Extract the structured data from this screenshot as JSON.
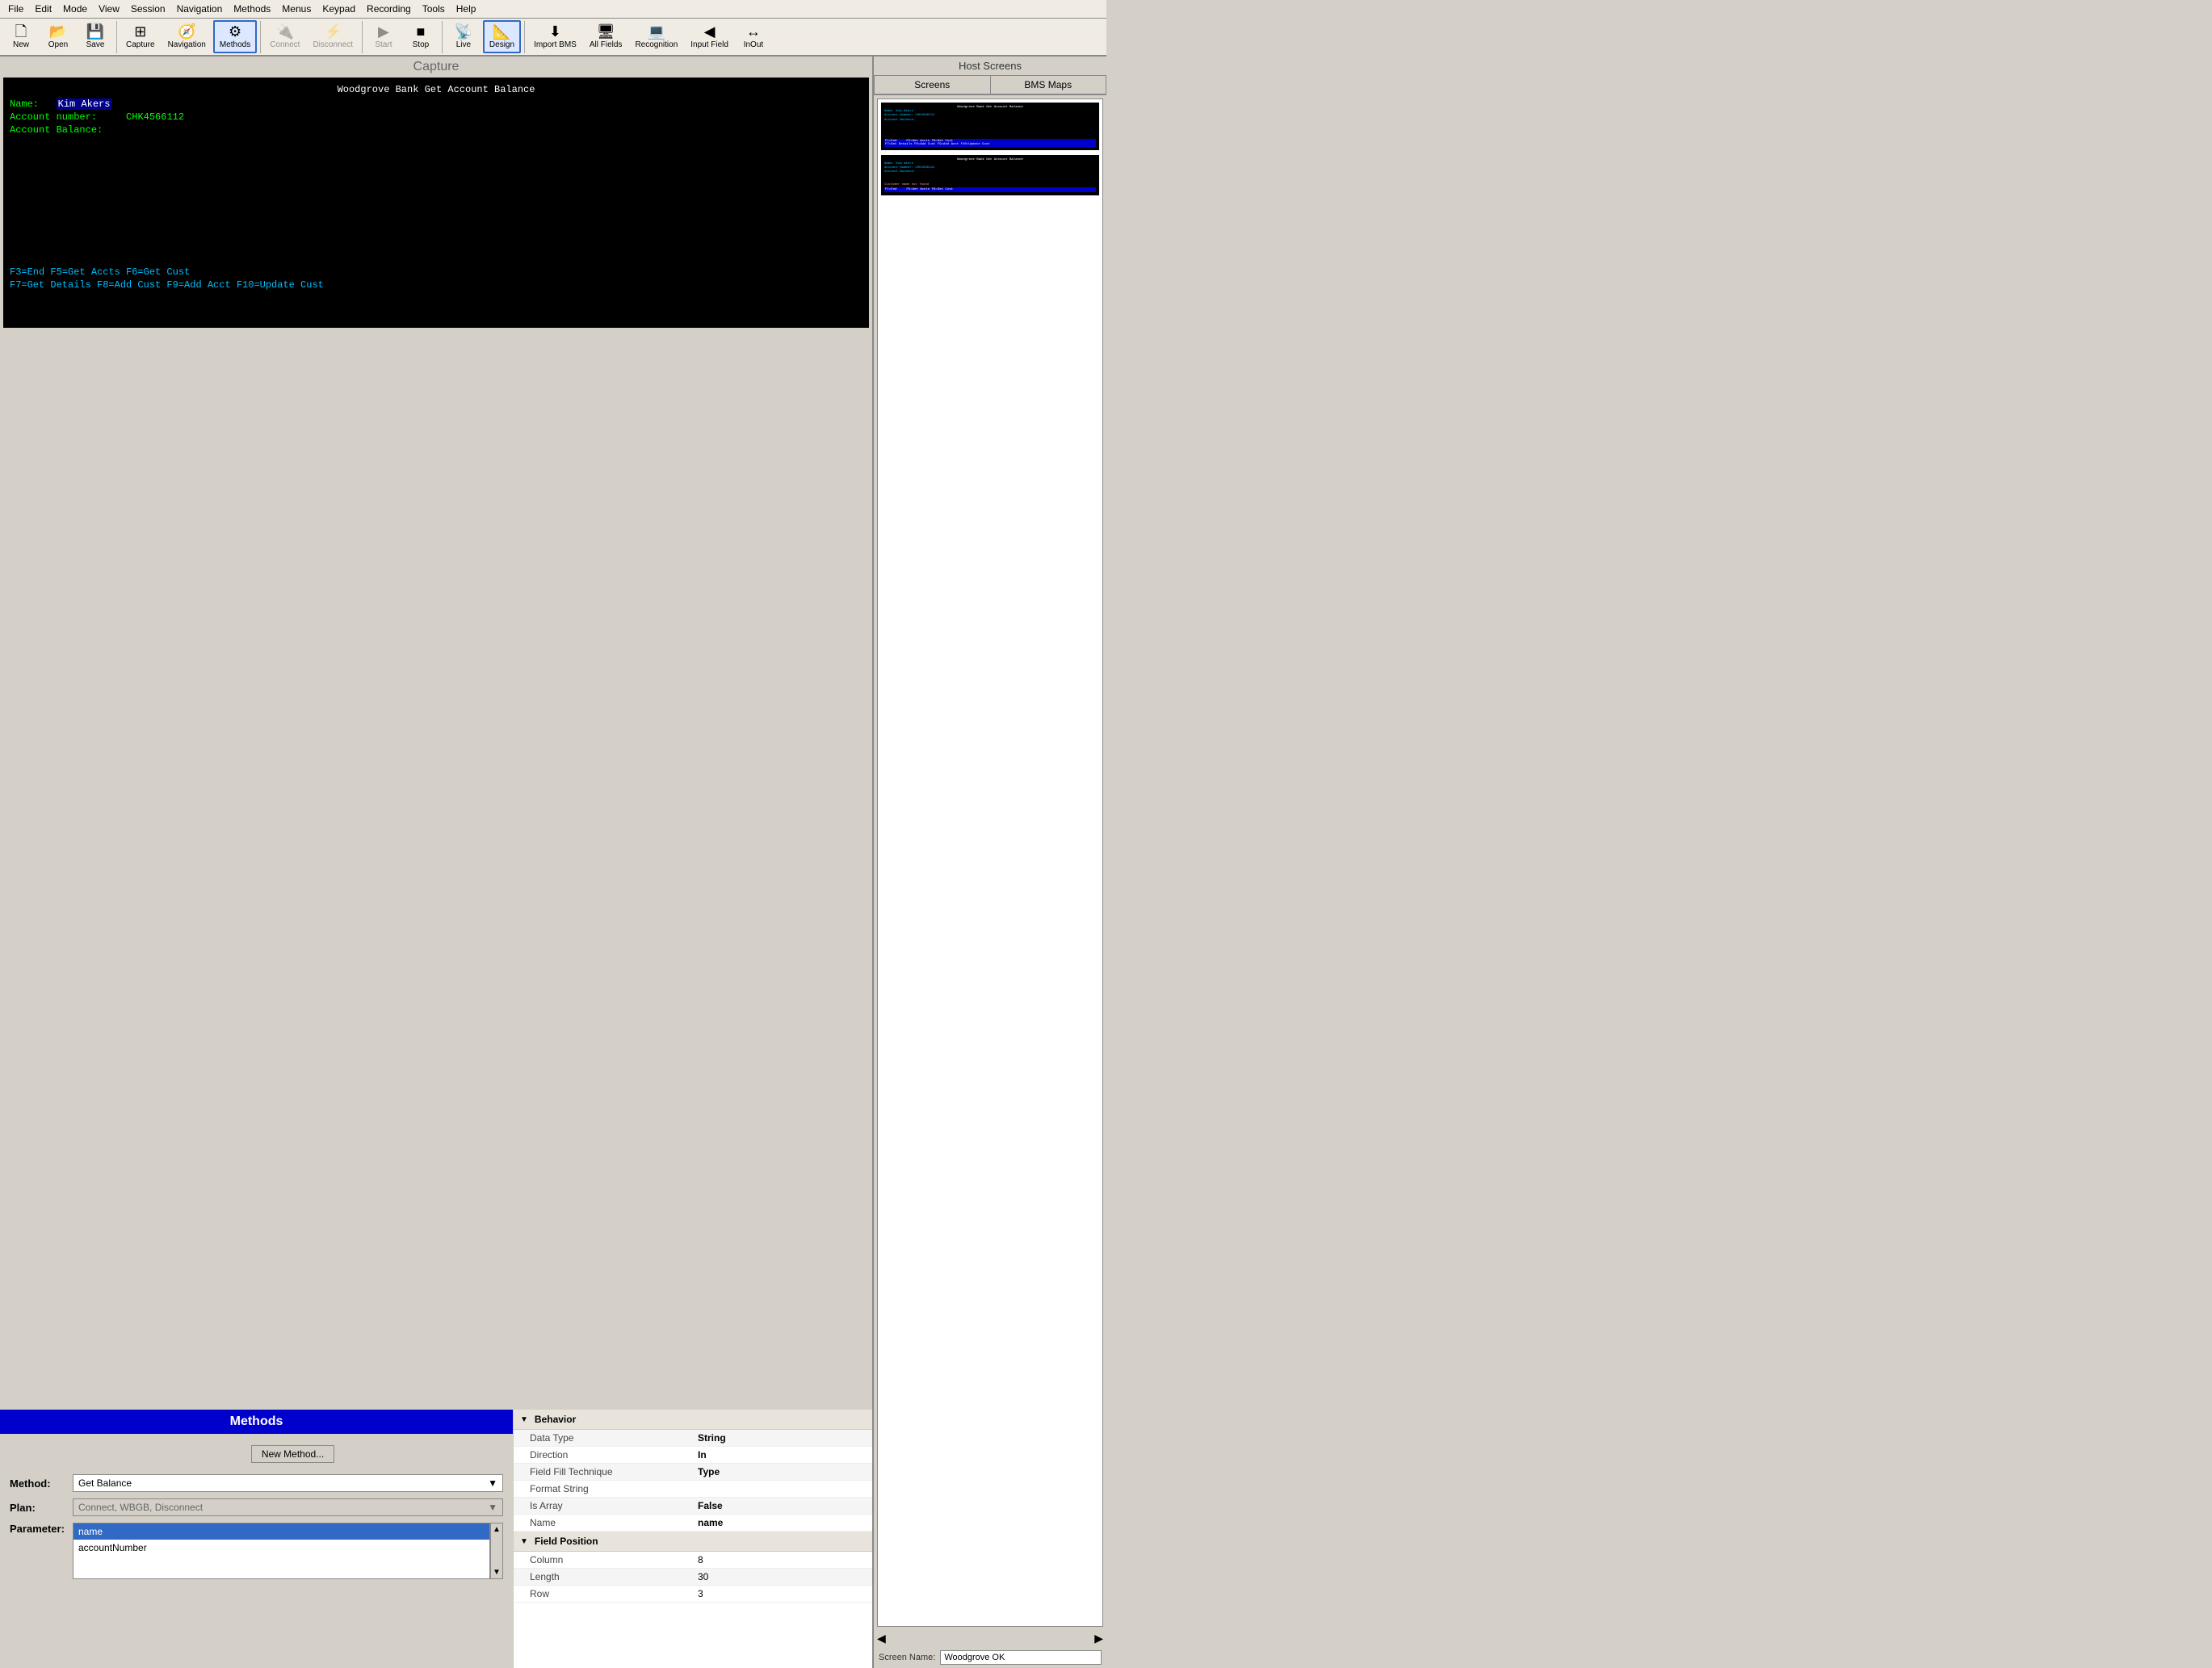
{
  "menubar": {
    "items": [
      "File",
      "Edit",
      "Mode",
      "View",
      "Session",
      "Navigation",
      "Methods",
      "Menus",
      "Keypad",
      "Recording",
      "Tools",
      "Help"
    ]
  },
  "toolbar": {
    "buttons": [
      {
        "label": "New",
        "icon": "🗋",
        "name": "new-btn",
        "disabled": false,
        "active": false
      },
      {
        "label": "Open",
        "icon": "📂",
        "name": "open-btn",
        "disabled": false,
        "active": false
      },
      {
        "label": "Save",
        "icon": "💾",
        "name": "save-btn",
        "disabled": false,
        "active": false
      },
      {
        "label": "Capture",
        "icon": "⊞",
        "name": "capture-btn",
        "disabled": false,
        "active": false
      },
      {
        "label": "Navigation",
        "icon": "🧭",
        "name": "navigation-btn",
        "disabled": false,
        "active": false
      },
      {
        "label": "Methods",
        "icon": "⚙",
        "name": "methods-btn",
        "disabled": false,
        "active": true
      },
      {
        "label": "Connect",
        "icon": "🔌",
        "name": "connect-btn",
        "disabled": true,
        "active": false
      },
      {
        "label": "Disconnect",
        "icon": "⚡",
        "name": "disconnect-btn",
        "disabled": true,
        "active": false
      },
      {
        "label": "Start",
        "icon": "▶",
        "name": "start-btn",
        "disabled": true,
        "active": false
      },
      {
        "label": "Stop",
        "icon": "■",
        "name": "stop-btn",
        "disabled": false,
        "active": false
      },
      {
        "label": "Live",
        "icon": "📡",
        "name": "live-btn",
        "disabled": false,
        "active": false
      },
      {
        "label": "Design",
        "icon": "📐",
        "name": "design-btn",
        "disabled": false,
        "active": true
      },
      {
        "label": "Import BMS",
        "icon": "⬇",
        "name": "import-bms-btn",
        "disabled": false,
        "active": false
      },
      {
        "label": "All Fields",
        "icon": "🖥",
        "name": "all-fields-btn",
        "disabled": false,
        "active": false
      },
      {
        "label": "Recognition",
        "icon": "💻",
        "name": "recognition-btn",
        "disabled": false,
        "active": false
      },
      {
        "label": "Input Field",
        "icon": "◀",
        "name": "input-field-btn",
        "disabled": false,
        "active": false
      },
      {
        "label": "InOut",
        "icon": "↔",
        "name": "inout-btn",
        "disabled": false,
        "active": false
      }
    ]
  },
  "capture": {
    "title": "Capture",
    "terminal": {
      "screen_title": "Woodgrove Bank Get Account Balance",
      "name_label": "Name:",
      "name_value": "Kim Akers",
      "account_number_label": "Account number:",
      "account_number_value": "CHK4566112",
      "account_balance_label": "Account Balance:",
      "keys_line1": "F3=End                    F5=Get Accts F6=Get Cust",
      "keys_line2": "F7=Get Details F8=Add Cust    F9=Add Acct  F10=Update Cust"
    }
  },
  "host_screens": {
    "title": "Host Screens",
    "tabs": [
      "Screens",
      "BMS Maps"
    ],
    "screen_name_label": "Screen Name:",
    "screen_name_value": "Woodgrove OK",
    "thumb1": {
      "title": "Woodgrove Bank Get Account Balance",
      "lines": [
        "Name: Kim Akers",
        "Account Number: CHK4566112",
        "Account Balance:"
      ]
    },
    "thumb2": {
      "title": "Woodgrove Bank Get Account Balance",
      "lines": [
        "Name: Kim Akers",
        "Account Number: CHK4566112",
        "Account Balance:"
      ],
      "error": "Customer name not found"
    }
  },
  "methods": {
    "header": "Methods",
    "new_method_label": "New Method...",
    "method_label": "Method:",
    "method_value": "Get Balance",
    "plan_label": "Plan:",
    "plan_value": "Connect, WBGB, Disconnect",
    "parameter_label": "Parameter:",
    "parameters": [
      "name",
      "accountNumber"
    ],
    "selected_param": 0
  },
  "properties": {
    "behavior_label": "Behavior",
    "field_position_label": "Field Position",
    "rows": [
      {
        "name": "Data Type",
        "value": "String",
        "bold": true
      },
      {
        "name": "Direction",
        "value": "In",
        "bold": true
      },
      {
        "name": "Field Fill Technique",
        "value": "Type",
        "bold": true
      },
      {
        "name": "Format String",
        "value": "",
        "bold": false
      },
      {
        "name": "Is Array",
        "value": "False",
        "bold": true
      },
      {
        "name": "Name",
        "value": "name",
        "bold": true
      }
    ],
    "position_rows": [
      {
        "name": "Column",
        "value": "8",
        "bold": false
      },
      {
        "name": "Length",
        "value": "30",
        "bold": false
      },
      {
        "name": "Row",
        "value": "3",
        "bold": false
      }
    ]
  }
}
